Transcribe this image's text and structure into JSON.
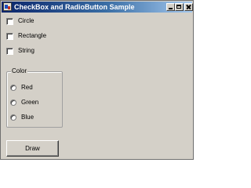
{
  "window": {
    "title": "CheckBox and RadioButton Sample"
  },
  "checkboxes": [
    {
      "label": "Circle",
      "checked": false
    },
    {
      "label": "Rectangle",
      "checked": false
    },
    {
      "label": "String",
      "checked": false
    }
  ],
  "color_group": {
    "label": "Color",
    "options": [
      {
        "label": "Red",
        "selected": false
      },
      {
        "label": "Green",
        "selected": false
      },
      {
        "label": "Blue",
        "selected": false
      }
    ]
  },
  "draw_button": {
    "label": "Draw"
  },
  "colors": {
    "face": "#d4d0c8",
    "title_start": "#0a246a",
    "title_end": "#a6caf0"
  },
  "icons": {
    "app": "app-icon",
    "minimize": "minimize-icon",
    "maximize": "maximize-icon",
    "close": "close-icon"
  }
}
